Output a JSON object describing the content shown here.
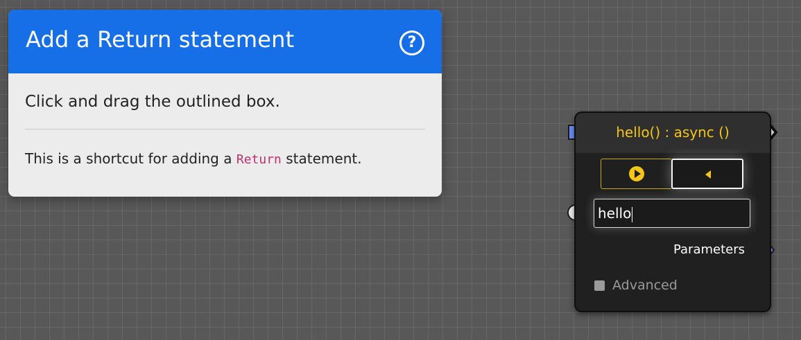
{
  "tutorial": {
    "title": "Add a Return statement",
    "help_icon": "question-circle-icon",
    "instruction": "Click and drag the outlined box.",
    "note_prefix": "This is a shortcut for adding a",
    "note_keyword": "Return",
    "note_suffix": "statement."
  },
  "node": {
    "title": "hello() : async ()",
    "run_icon": "play-circle-icon",
    "back_icon": "triangle-left-icon",
    "name_value": "hello",
    "parameters_label": "Parameters",
    "advanced_label": "Advanced",
    "advanced_checked": false
  },
  "colors": {
    "canvas": "#585858",
    "tutorial_header": "#176fe7",
    "node_title": "#f5c518",
    "exec_in_pin": "#6c8ef5",
    "params_pin": "#a78bfa",
    "keyword": "#c0306e"
  }
}
